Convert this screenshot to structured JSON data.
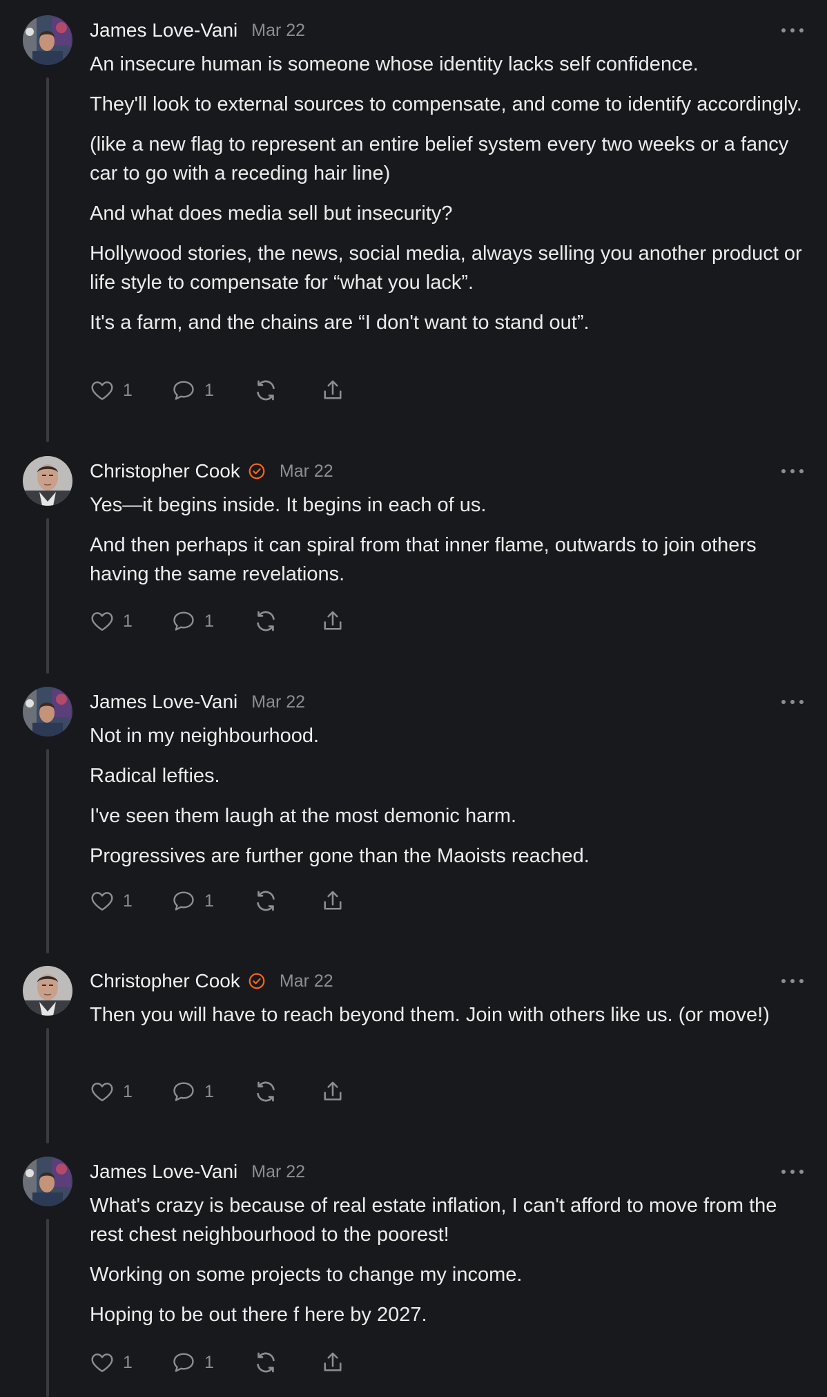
{
  "comments": [
    {
      "author": "James Love-Vani",
      "avatar": "avatar-james",
      "verified": false,
      "date": "Mar 22",
      "paragraphs": [
        "An insecure human is someone whose identity lacks self confidence.",
        "They'll look to external sources to compensate, and come to identify accordingly.",
        "(like a new flag to represent an entire belief system every two weeks or a fancy car to go with a receding hair line)",
        "And what does media sell but insecurity?",
        "Hollywood stories, the news, social media, always selling you another product or life style to compensate for “what you lack”.",
        "It's a farm, and the chains are “I don't want to stand out”."
      ],
      "likes": "1",
      "replies": "1"
    },
    {
      "author": "Christopher Cook",
      "avatar": "avatar-christopher",
      "verified": true,
      "date": "Mar 22",
      "paragraphs": [
        "Yes—it begins inside. It begins in each of us.",
        "And then perhaps it can spiral from that inner flame, outwards to join others having the same revelations."
      ],
      "likes": "1",
      "replies": "1"
    },
    {
      "author": "James Love-Vani",
      "avatar": "avatar-james",
      "verified": false,
      "date": "Mar 22",
      "paragraphs": [
        "Not in my neighbourhood.",
        "Radical lefties.",
        "I've seen them laugh at the most demonic harm.",
        "Progressives are further gone than the Maoists reached."
      ],
      "likes": "1",
      "replies": "1"
    },
    {
      "author": "Christopher Cook",
      "avatar": "avatar-christopher",
      "verified": true,
      "date": "Mar 22",
      "paragraphs": [
        "Then you will have to reach beyond them. Join with others like us. (or move!)"
      ],
      "likes": "1",
      "replies": "1"
    },
    {
      "author": "James Love-Vani",
      "avatar": "avatar-james",
      "verified": false,
      "date": "Mar 22",
      "paragraphs": [
        "What's crazy is because of real estate inflation, I can't afford to move from the rest chest neighbourhood to the poorest!",
        "Working on some projects to change my income.",
        "Hoping to be out there f here by 2027."
      ],
      "likes": "1",
      "replies": "1"
    }
  ],
  "icons": {
    "like": "heart-icon",
    "reply": "speech-bubble-icon",
    "restack": "restack-icon",
    "share": "share-icon",
    "more": "ellipsis-icon",
    "verified": "verified-check-icon"
  },
  "colors": {
    "background": "#18191c",
    "text": "#ececec",
    "muted": "#8d8e93",
    "verified": "#ff6719",
    "thread_line": "#3a3b3f"
  }
}
